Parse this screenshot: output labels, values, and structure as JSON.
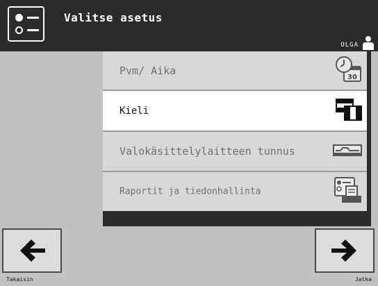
{
  "header": {
    "title": "Valitse asetus",
    "icon": "settings-list-icon",
    "user": "OLGA",
    "user_icon": "user-icon"
  },
  "menu": {
    "items": [
      {
        "label": "Pvm/ Aika",
        "icon": "calendar-clock-icon",
        "calendar_day": "30",
        "selected": false
      },
      {
        "label": "Kieli",
        "icon": "language-flag-icon",
        "selected": true
      },
      {
        "label": "Valokäsittelylaitteen tunnus",
        "icon": "device-id-icon",
        "selected": false
      },
      {
        "label": "Raportit ja tiedonhallinta",
        "icon": "reports-data-icon",
        "selected": false
      }
    ]
  },
  "nav": {
    "back_label": "Takaisin",
    "next_label": "Jatka",
    "back_icon": "arrow-left-icon",
    "next_icon": "arrow-right-icon"
  },
  "colors": {
    "dark": "#2b2b2b",
    "panel_gray": "#c2c2c2",
    "item_bg": "#d8d8d8",
    "selected_bg": "#ffffff"
  }
}
